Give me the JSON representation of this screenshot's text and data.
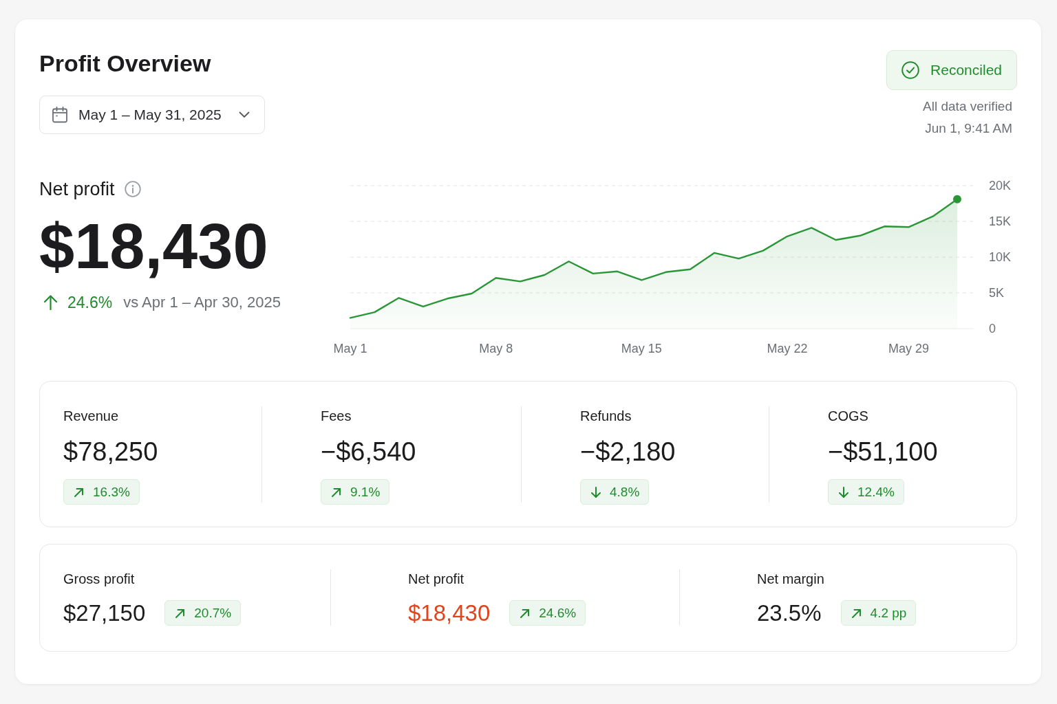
{
  "header": {
    "title": "Profit Overview",
    "date_range": {
      "label": "May 1 – May 31, 2025"
    }
  },
  "status": {
    "label": "Reconciled",
    "note": "All data verified",
    "time": "Jun 1, 9:41 AM"
  },
  "net_profit": {
    "label": "Net profit",
    "value": "$18,430",
    "change": {
      "kind": "up",
      "value": "24.6%"
    },
    "comparison": "vs Apr 1 – Apr 30, 2025",
    "chart_data": {
      "type": "area",
      "categories": [
        "May 1",
        null,
        null,
        null,
        null,
        null,
        "May 8",
        null,
        null,
        null,
        null,
        null,
        "May 15",
        null,
        null,
        null,
        null,
        null,
        "May 22",
        null,
        null,
        null,
        null,
        "May 29",
        null,
        null
      ],
      "series": [
        {
          "color": "#2a9637",
          "values": [
            1500,
            2300,
            4300,
            3100,
            4200,
            4900,
            7100,
            6600,
            7500,
            9400,
            7700,
            8000,
            6800,
            7900,
            8300,
            10600,
            9800,
            10900,
            12900,
            14100,
            12400,
            13000,
            14300,
            14200,
            15700,
            18100
          ]
        }
      ],
      "ylim": [
        0,
        20000
      ],
      "yticks": [
        {
          "value": 0,
          "label": "0"
        },
        {
          "value": 5000,
          "label": "5K"
        },
        {
          "value": 10000,
          "label": "10K"
        },
        {
          "value": 15000,
          "label": "15K"
        },
        {
          "value": 20000,
          "label": "20K"
        }
      ],
      "grid": true
    }
  },
  "breakdown": [
    {
      "label": "Revenue",
      "value": "$78,250",
      "change": {
        "kind": "up",
        "value": "16.3%"
      }
    },
    {
      "label": "Fees",
      "value": "−$6,540",
      "change": {
        "kind": "up",
        "value": "9.1%"
      }
    },
    {
      "label": "Refunds",
      "value": "−$2,180",
      "change": {
        "kind": "down",
        "value": "4.8%"
      }
    },
    {
      "label": "COGS",
      "value": "−$51,100",
      "change": {
        "kind": "down",
        "value": "12.4%"
      }
    }
  ],
  "summary": [
    {
      "label": "Gross profit",
      "value": "$27,150",
      "highlight": false,
      "change": {
        "kind": "up",
        "value": "20.7%"
      }
    },
    {
      "label": "Net profit",
      "value": "$18,430",
      "highlight": true,
      "change": {
        "kind": "up",
        "value": "24.6%"
      }
    },
    {
      "label": "Net margin",
      "value": "23.5%",
      "highlight": false,
      "change": {
        "kind": "up",
        "value": "4.2 pp"
      }
    }
  ]
}
